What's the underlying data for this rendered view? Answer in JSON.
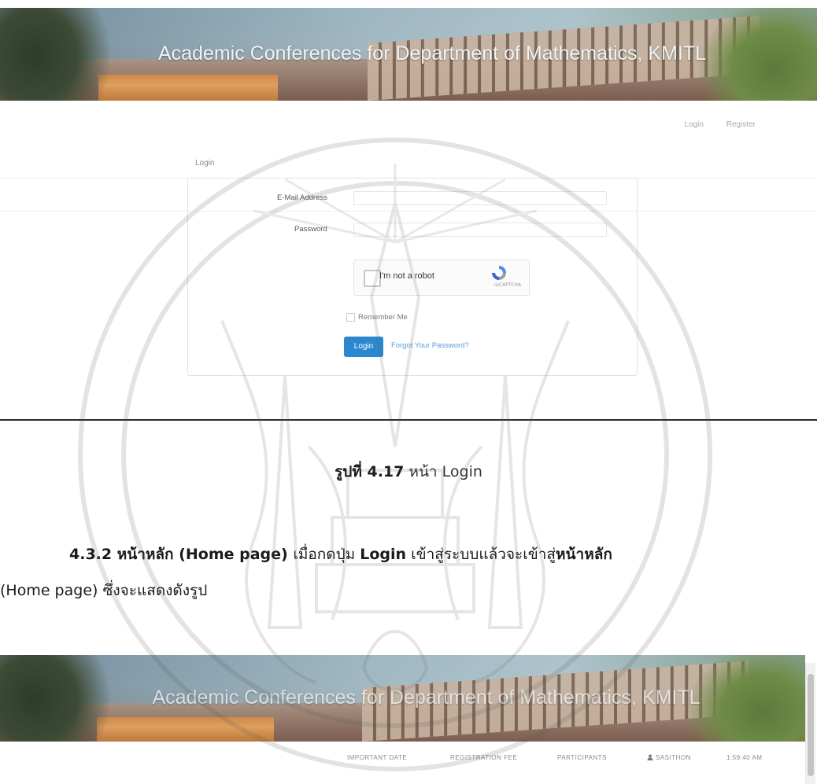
{
  "screenshot1": {
    "banner_title": "Academic Conferences for Department of Mathematics, KMITL",
    "nav": {
      "login": "Login",
      "register": "Register"
    },
    "form": {
      "heading": "Login",
      "email_label": "E-Mail Address",
      "password_label": "Password",
      "captcha_text": "I'm not a robot",
      "captcha_brand": "reCAPTCHA",
      "remember_label": "Remember Me",
      "login_button": "Login",
      "forgot_link": "Forgot Your Password?"
    }
  },
  "document": {
    "caption_bold": "รูปที่ 4.17",
    "caption_rest": "หน้า Login",
    "para1_a": "4.3.2 หน้าหลัก (Home page) ",
    "para1_b": "เมื่อกดปุ่ม ",
    "para1_c": "Login",
    "para1_d": " เข้าสู่ระบบแล้วจะเข้าสู่",
    "para1_e": "หน้าหลัก",
    "para2": "(Home page) ซึ่งจะแสดงดังรูป"
  },
  "screenshot2": {
    "banner_title": "Academic Conferences for Department of Mathematics, KMITL",
    "nav": {
      "important_date": "IMPORTANT DATE",
      "registration_fee": "REGISTRATION FEE",
      "participants": "PARTICIPANTS",
      "user": "SASITHON",
      "time": "1:59:40 AM"
    }
  },
  "colors": {
    "login_button": "#2b88cf",
    "link": "#5b9bd5"
  }
}
